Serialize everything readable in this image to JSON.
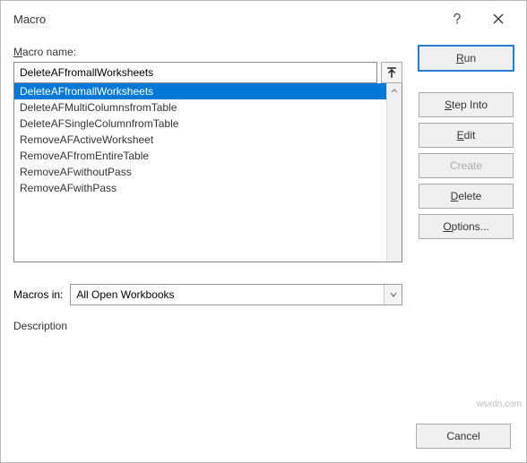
{
  "dialog_title": "Macro",
  "name_label_pre": "M",
  "name_label_rest": "acro name:",
  "name_value": "DeleteAFfromallWorksheets",
  "list_items": [
    {
      "label": "DeleteAFfromallWorksheets",
      "selected": true
    },
    {
      "label": "DeleteAFMultiColumnsfromTable",
      "selected": false
    },
    {
      "label": "DeleteAFSingleColumnfromTable",
      "selected": false
    },
    {
      "label": "RemoveAFActiveWorksheet",
      "selected": false
    },
    {
      "label": "RemoveAFfromEntireTable",
      "selected": false
    },
    {
      "label": "RemoveAFwithoutPass",
      "selected": false
    },
    {
      "label": "RemoveAFwithPass",
      "selected": false
    }
  ],
  "macros_in_pre": "M",
  "macros_in_u": "a",
  "macros_in_rest": "cros in:",
  "macros_in_value": "All Open Workbooks",
  "description_label": "Description",
  "buttons": {
    "run": {
      "u": "R",
      "rest": "un"
    },
    "step_into": {
      "u": "S",
      "rest": "tep Into"
    },
    "edit": {
      "u": "E",
      "rest": "dit"
    },
    "create": {
      "u": "C",
      "rest": "reate"
    },
    "delete": {
      "u": "D",
      "rest": "elete"
    },
    "options": {
      "u": "O",
      "rest": "ptions..."
    },
    "cancel": "Cancel"
  },
  "watermark": "wsxdn.com"
}
